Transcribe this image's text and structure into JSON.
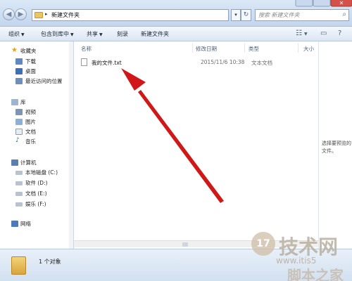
{
  "window": {
    "address_path": "新建文件夹",
    "search_placeholder": "搜索 新建文件夹"
  },
  "toolbar": {
    "organize": "组织",
    "include_in_library": "包含到库中",
    "share": "共享",
    "burn": "刻录",
    "new_folder": "新建文件夹"
  },
  "sidebar": {
    "favorites": "收藏夹",
    "downloads": "下载",
    "desktop": "桌面",
    "recent": "最近访问的位置",
    "libraries": "库",
    "videos": "视频",
    "pictures": "图片",
    "documents": "文档",
    "music": "音乐",
    "computer": "计算机",
    "drive_c": "本地磁盘 (C:)",
    "drive_d": "软件 (D:)",
    "drive_e": "文档 (E:)",
    "drive_f": "娱乐 (F:)",
    "network": "网络"
  },
  "columns": {
    "name": "名称",
    "modified": "修改日期",
    "type": "类型",
    "size": "大小"
  },
  "files": [
    {
      "name": "我的文件.txt",
      "modified": "2015/11/6 10:38",
      "type": "文本文档"
    }
  ],
  "preview": {
    "empty_text": "选择要预览的文件。"
  },
  "status": {
    "count_text": "1 个对象"
  },
  "watermark": {
    "logo_text": "17",
    "title": "技术网",
    "url": "www.itis5",
    "site": "脚本之家"
  },
  "colors": {
    "arrow": "#d01818",
    "selection": "#cfe3fb",
    "folder": "#e9c565"
  }
}
